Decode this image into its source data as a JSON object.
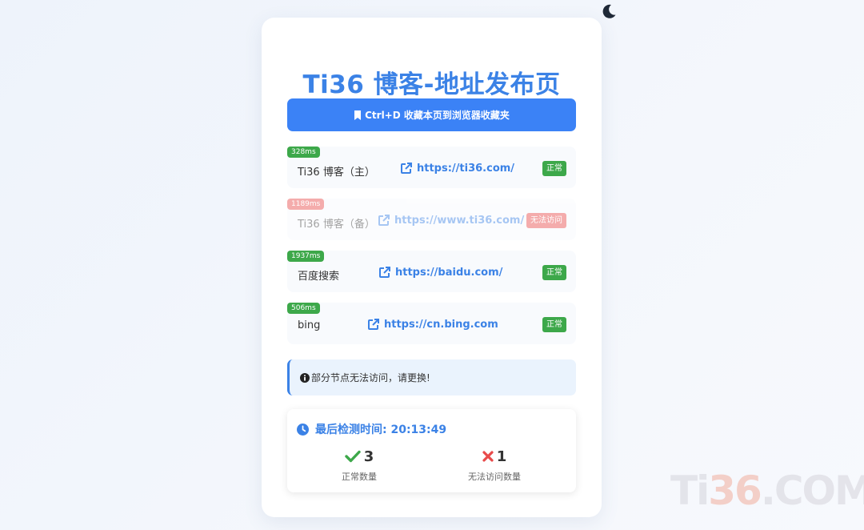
{
  "page": {
    "title": "Ti36 博客-地址发布页",
    "bookmark_button": "Ctrl+D 收藏本页到浏览器收藏夹"
  },
  "theme_toggle": {
    "icon": "moon-icon"
  },
  "links": [
    {
      "latency": "328ms",
      "name": "Ti36 博客（主）",
      "url": "https://ti36.com/",
      "status": "正常",
      "ok": true
    },
    {
      "latency": "1189ms",
      "name": "Ti36 博客（备）",
      "url": "https://www.ti36.com/",
      "status": "无法访问",
      "ok": false
    },
    {
      "latency": "1937ms",
      "name": "百度搜索",
      "url": "https://baidu.com/",
      "status": "正常",
      "ok": true
    },
    {
      "latency": "506ms",
      "name": "bing",
      "url": "https://cn.bing.com",
      "status": "正常",
      "ok": true
    }
  ],
  "notice": {
    "text": "部分节点无法访问，请更换!",
    "icon": "info-icon"
  },
  "stats": {
    "last_check_label": "最后检测时间: 20:13:49",
    "ok_count": "3",
    "ok_label": "正常数量",
    "fail_count": "1",
    "fail_label": "无法访问数量"
  },
  "watermark": {
    "left": "Ti",
    "mid": "36",
    "right": ".COM"
  },
  "colors": {
    "accent": "#3b82f6",
    "ok": "#3da84a",
    "error": "#e84a4a"
  }
}
